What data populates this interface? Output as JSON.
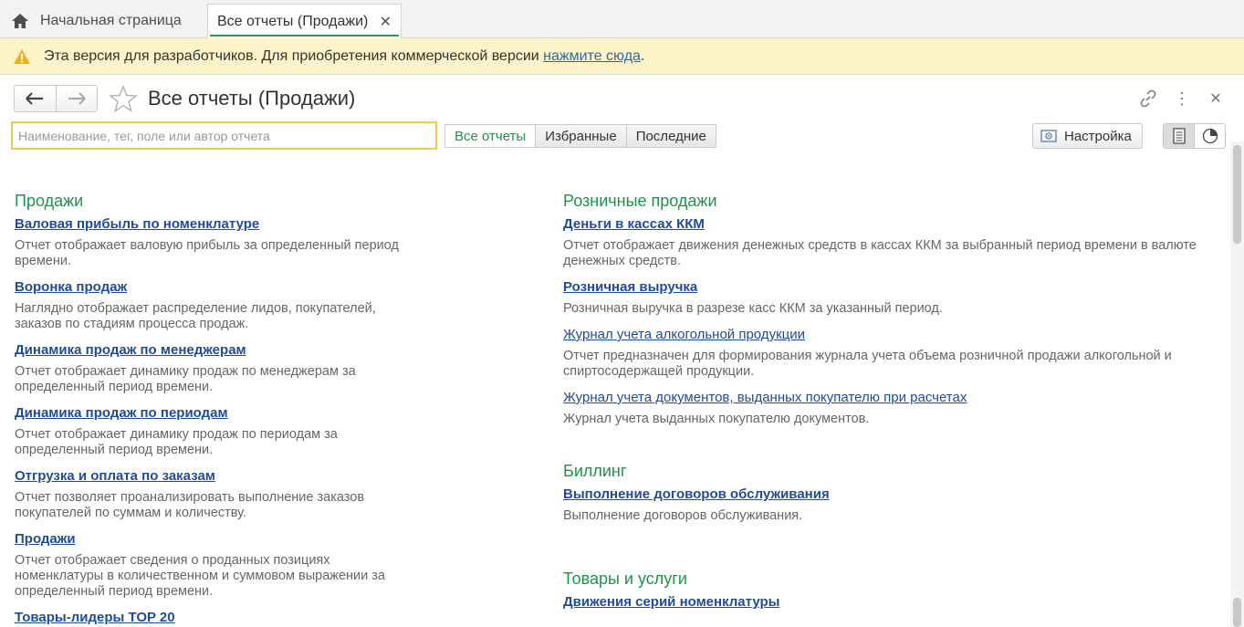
{
  "tabs": {
    "home_label": "Начальная страница",
    "active_label": "Все отчеты (Продажи)",
    "close_symbol": "✕"
  },
  "banner": {
    "text": "Эта версия для разработчиков. Для приобретения коммерческой версии ",
    "link": "нажмите сюда",
    "suffix": "."
  },
  "header": {
    "title": "Все отчеты (Продажи)",
    "back_symbol": "🡐",
    "forward_symbol": "🡒",
    "more_symbol": "⋮",
    "close_symbol": "✕"
  },
  "search": {
    "placeholder": "Наименование, тег, поле или автор отчета",
    "value": ""
  },
  "filters": {
    "all": "Все отчеты",
    "favorites": "Избранные",
    "recent": "Последние",
    "selected": "all"
  },
  "settings_label": "Настройка",
  "colors": {
    "accent_green": "#20934a",
    "link_blue": "#1f4c9a",
    "banner_bg": "#fcf4c8",
    "search_border": "#f0cc57"
  },
  "left_sections": [
    {
      "title": "Продажи",
      "reports": [
        {
          "name": "Валовая прибыль по номенклатуре",
          "desc": "Отчет отображает валовую прибыль за определенный период времени."
        },
        {
          "name": "Воронка продаж",
          "desc": "Наглядно отображает распределение лидов, покупателей, заказов по стадиям процесса продаж."
        },
        {
          "name": "Динамика продаж по менеджерам",
          "desc": "Отчет отображает динамику продаж по менеджерам за определенный период времени."
        },
        {
          "name": "Динамика продаж по периодам",
          "desc": "Отчет отображает динамику продаж по периодам за определенный период времени."
        },
        {
          "name": "Отгрузка и оплата по заказам",
          "desc": "Отчет позволяет проанализировать выполнение заказов покупателей по суммам и количеству."
        },
        {
          "name": "Продажи",
          "desc": "Отчет отображает сведения о проданных позициях номенклатуры в количественном и суммовом выражении за определенный период времени."
        },
        {
          "name": "Товары-лидеры TOP 20",
          "desc": ""
        }
      ]
    }
  ],
  "right_sections": [
    {
      "title": "Розничные продажи",
      "reports": [
        {
          "name": "Деньги в кассах ККМ",
          "bold": true,
          "desc": "Отчет отображает движения денежных средств в кассах ККМ за выбранный период времени в валюте денежных средств."
        },
        {
          "name": "Розничная выручка",
          "bold": true,
          "desc": "Розничная выручка в разрезе касс ККМ за указанный период."
        },
        {
          "name": "Журнал учета алкогольной продукции",
          "bold": false,
          "desc": "Отчет предназначен для формирования журнала учета объема розничной продажи алкогольной и спиртосодержащей продукции."
        },
        {
          "name": "Журнал учета документов, выданных покупателю при расчетах",
          "bold": false,
          "desc": "Журнал учета выданных покупателю документов."
        }
      ]
    },
    {
      "title": "Биллинг",
      "reports": [
        {
          "name": "Выполнение договоров обслуживания",
          "bold": true,
          "desc": "Выполнение договоров обслуживания."
        }
      ]
    },
    {
      "title": "Товары и услуги",
      "reports": [
        {
          "name": "Движения серий номенклатуры",
          "bold": true,
          "desc": ""
        }
      ]
    }
  ]
}
